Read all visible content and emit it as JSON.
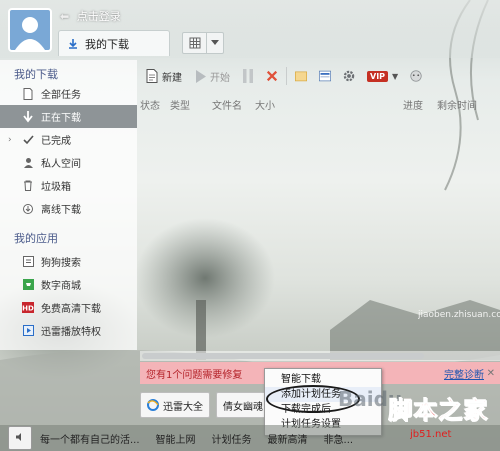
{
  "colors": {
    "accent": "#c53023",
    "sidebar_active": "#8e9497",
    "alert_bg": "#f4b4b8",
    "alert_text": "#b4232a",
    "link": "#1e55b0",
    "watermark": "#e11e1e"
  },
  "header": {
    "login_text": "点击登录",
    "tab_label": "我的下载"
  },
  "sidebar": {
    "section1_title": "我的下载",
    "items": [
      {
        "label": "全部任务",
        "icon": "document-icon"
      },
      {
        "label": "正在下载",
        "icon": "download-arrow-icon"
      },
      {
        "label": "已完成",
        "icon": "check-icon"
      },
      {
        "label": "私人空间",
        "icon": "person-icon"
      },
      {
        "label": "垃圾箱",
        "icon": "trash-icon"
      },
      {
        "label": "离线下载",
        "icon": "cloud-icon"
      }
    ],
    "section2_title": "我的应用",
    "apps": [
      {
        "label": "狗狗搜索",
        "icon": "dog-icon"
      },
      {
        "label": "数字商城",
        "icon": "cart-icon"
      },
      {
        "label": "免费高清下载",
        "icon": "hd-icon"
      },
      {
        "label": "迅雷播放特权",
        "icon": "play-icon"
      }
    ]
  },
  "toolbar": {
    "new_label": "新建",
    "start_label": "开始",
    "vip_label": "VIP"
  },
  "columns": [
    "状态",
    "类型",
    "文件名",
    "大小",
    "进度",
    "剩余时间"
  ],
  "alert": {
    "message": "您有1个问题需要修复",
    "link": "完整诊断"
  },
  "buttons": [
    {
      "label": "迅雷大全",
      "icon": "ie-icon"
    },
    {
      "label": "倩女幽魂",
      "icon": ""
    }
  ],
  "context_menu": [
    "智能下载",
    "添加计划任务",
    "下载完成后",
    "计划任务设置"
  ],
  "bottombar": {
    "items": [
      "每一个都有自己的活...",
      "智能上网",
      "计划任务",
      "最新高清",
      "非急..."
    ]
  },
  "watermark": {
    "main": "脚本之家",
    "url": "jb51.net",
    "baidu": "Baidu",
    "jb": "jiaoben.zhisuan.com"
  }
}
